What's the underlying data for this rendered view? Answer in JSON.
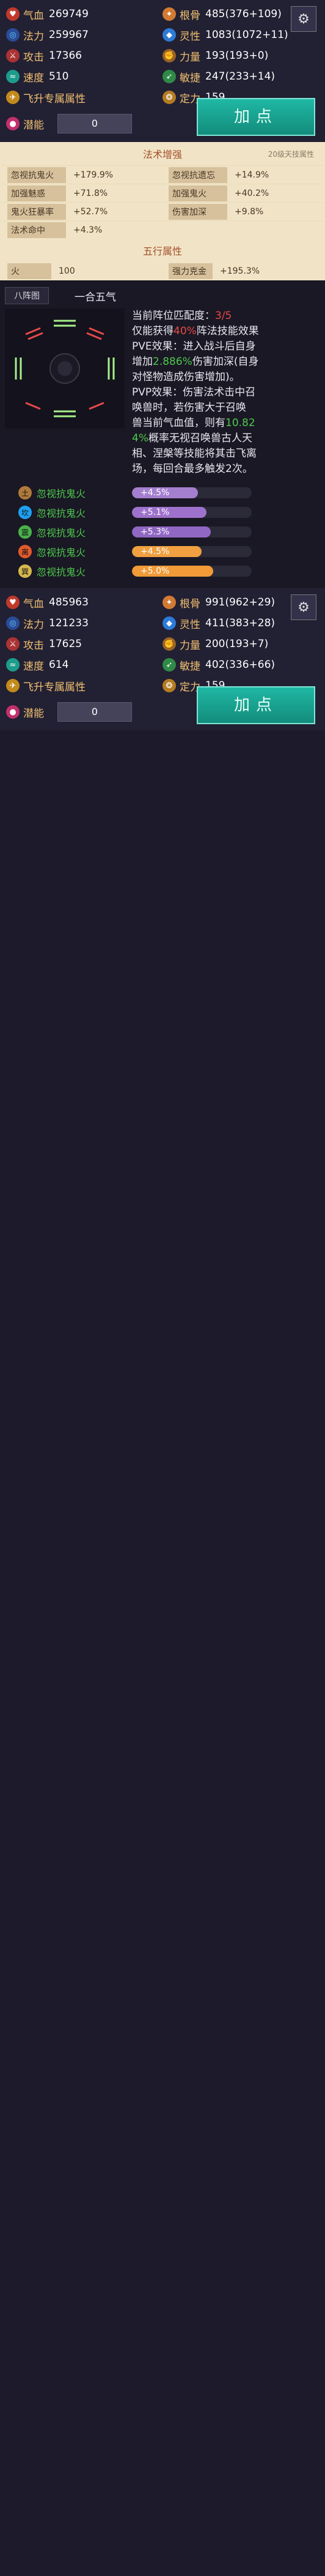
{
  "stats": {
    "hp": {
      "label": "气血",
      "value": "269749"
    },
    "gengu": {
      "label": "根骨",
      "value": "485(376+109)"
    },
    "mana": {
      "label": "法力",
      "value": "259967"
    },
    "lingxing": {
      "label": "灵性",
      "value": "1083(1072+11)"
    },
    "attack": {
      "label": "攻击",
      "value": "17366"
    },
    "liliang": {
      "label": "力量",
      "value": "193(193+0)"
    },
    "speed": {
      "label": "速度",
      "value": "510"
    },
    "minjie": {
      "label": "敏捷",
      "value": "247(233+14)"
    },
    "title": {
      "label": "飞升专属属性",
      "extra_label": "定力",
      "extra_value": "159"
    },
    "potential": {
      "label": "潜能",
      "value": "0"
    },
    "add_button": "加点"
  },
  "spell": {
    "heading": "法术增强",
    "note": "20级天技属性",
    "items": [
      {
        "label": "忽视抗鬼火",
        "value": "+179.9%"
      },
      {
        "label": "忽视抗遗忘",
        "value": "+14.9%"
      },
      {
        "label": "加强魅惑",
        "value": "+71.8%"
      },
      {
        "label": "加强鬼火",
        "value": "+40.2%"
      },
      {
        "label": "鬼火狂暴率",
        "value": "+52.7%"
      },
      {
        "label": "伤害加深",
        "value": "+9.8%"
      },
      {
        "label": "法术命中",
        "value": "+4.3%"
      },
      {
        "label": "",
        "value": ""
      }
    ]
  },
  "elements": {
    "heading": "五行属性",
    "items": [
      {
        "label": "火",
        "value": "100"
      },
      {
        "label": "强力克金",
        "value": "+195.3%"
      }
    ]
  },
  "formation": {
    "tag": "八阵图",
    "name": "一合五气",
    "desc_lines": [
      {
        "text": "当前阵位匹配度：",
        "highlight": "3/5"
      },
      {
        "text": "仅能获得",
        "highlight": "40%",
        "tail": "阵法技能效果"
      },
      {
        "text": "PVE效果：进入战斗后自身"
      },
      {
        "text": "增加",
        "highlight": "2.886%",
        "tail": "伤害加深(自身"
      },
      {
        "text": "对怪物造成伤害增加)。"
      },
      {
        "text": "PVP效果：伤害法术击中召"
      },
      {
        "text": "唤兽时，若伤害大于召唤"
      },
      {
        "text": "兽当前气血值，则有",
        "highlight": "10.82"
      },
      {
        "text": "",
        "highlight": "4%",
        "tail": "概率无视召唤兽古人天"
      },
      {
        "text": "相、涅槃等技能将其击飞离"
      },
      {
        "text": "场，每回合最多触发2次。"
      }
    ],
    "bars": [
      {
        "elem": "土",
        "label": "忽视抗鬼火",
        "value": "+4.5%",
        "fill": 0.55,
        "color": "#a57fcf"
      },
      {
        "elem": "坎",
        "label": "忽视抗鬼火",
        "value": "+5.1%",
        "fill": 0.62,
        "color": "#9e72cc"
      },
      {
        "elem": "震",
        "label": "忽视抗鬼火",
        "value": "+5.3%",
        "fill": 0.66,
        "color": "#9068c4"
      },
      {
        "elem": "离",
        "label": "忽视抗鬼火",
        "value": "+4.5%",
        "fill": 0.58,
        "color": "#f0a040"
      },
      {
        "elem": "巽",
        "label": "忽视抗鬼火",
        "value": "+5.0%",
        "fill": 0.68,
        "color": "#f09a38"
      }
    ],
    "elem_colors": [
      "#b07a3a",
      "#1da1f2",
      "#49b24a",
      "#e05a2c",
      "#d6b84d"
    ]
  },
  "stats2": {
    "hp": {
      "label": "气血",
      "value": "485963"
    },
    "gengu": {
      "label": "根骨",
      "value": "991(962+29)"
    },
    "mana": {
      "label": "法力",
      "value": "121233"
    },
    "lingxing": {
      "label": "灵性",
      "value": "411(383+28)"
    },
    "attack": {
      "label": "攻击",
      "value": "17625"
    },
    "liliang": {
      "label": "力量",
      "value": "200(193+7)"
    },
    "speed": {
      "label": "速度",
      "value": "614"
    },
    "minjie": {
      "label": "敏捷",
      "value": "402(336+66)"
    },
    "title": {
      "label": "飞升专属属性",
      "extra_label": "定力",
      "extra_value": "159"
    },
    "potential": {
      "label": "潜能",
      "value": "0"
    },
    "add_button": "加点"
  }
}
